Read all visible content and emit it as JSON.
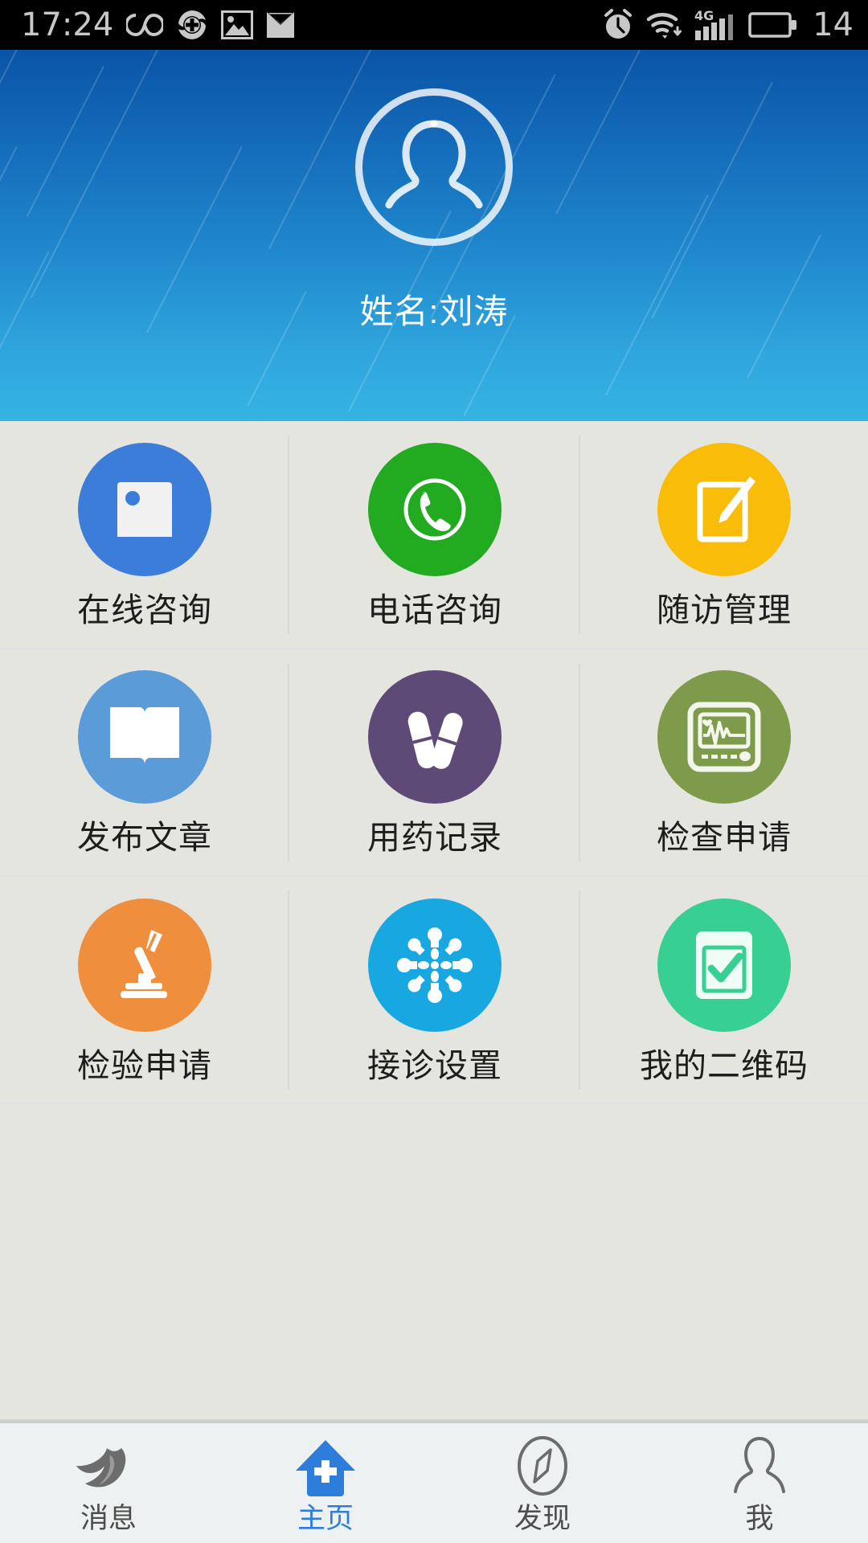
{
  "status_bar": {
    "time": "17:24",
    "battery_level": "14",
    "left_icons": [
      "infinity-icon",
      "health-plus-icon",
      "photo-icon",
      "mail-icon"
    ],
    "right_icons": [
      "alarm-clock-icon",
      "wifi-icon",
      "4g-signal-icon",
      "battery-icon"
    ],
    "network_label": "4G",
    "background": "#000000",
    "foreground": "#c8c8c8"
  },
  "header": {
    "avatar_icon": "user-avatar-icon",
    "username": "姓名:刘涛",
    "gradient_top": "#0a54a8",
    "gradient_bottom": "#35b4e3"
  },
  "grid": {
    "items": [
      {
        "label": "在线咨询",
        "icon": "image-photo-icon",
        "color": "#3b7dd8"
      },
      {
        "label": "电话咨询",
        "icon": "phone-call-icon",
        "color": "#22ab20"
      },
      {
        "label": "随访管理",
        "icon": "edit-pencil-note-icon",
        "color": "#f9bc09"
      },
      {
        "label": "发布文章",
        "icon": "open-book-icon",
        "color": "#5b9bd8"
      },
      {
        "label": "用药记录",
        "icon": "pill-capsule-icon",
        "color": "#5e4a77"
      },
      {
        "label": "检查申请",
        "icon": "heart-monitor-icon",
        "color": "#7e9a4b"
      },
      {
        "label": "检验申请",
        "icon": "microscope-icon",
        "color": "#ef8f3e"
      },
      {
        "label": "接诊设置",
        "icon": "snowflake-settings-icon",
        "color": "#17a8e2"
      },
      {
        "label": "我的二维码",
        "icon": "checkbox-qrcode-icon",
        "color": "#37cf92"
      }
    ]
  },
  "tab_bar": {
    "active_color": "#2f7ddb",
    "inactive_color": "#4d4d4d",
    "tabs": [
      {
        "label": "消息",
        "icon": "dove-bird-icon",
        "active": false
      },
      {
        "label": "主页",
        "icon": "home-cross-icon",
        "active": true
      },
      {
        "label": "发现",
        "icon": "compass-icon",
        "active": false
      },
      {
        "label": "我",
        "icon": "person-icon",
        "active": false
      }
    ]
  }
}
